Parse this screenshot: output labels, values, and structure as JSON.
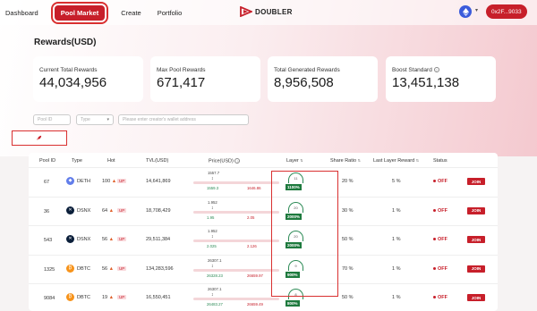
{
  "nav": {
    "links": [
      "Dashboard",
      "Pool Market",
      "Create",
      "Portfolio"
    ],
    "active": "Pool Market",
    "logo_text": "DOUBLER",
    "wallet": "0x2F...9033"
  },
  "page": {
    "title": "Rewards(USD)"
  },
  "stats": [
    {
      "label": "Current Total Rewards",
      "value": "44,034,956"
    },
    {
      "label": "Max Pool Rewards",
      "value": "671,417"
    },
    {
      "label": "Total Generated Rewards",
      "value": "8,956,508"
    },
    {
      "label": "Boost Standard",
      "value": "13,451,138"
    }
  ],
  "filters": {
    "pool_id_placeholder": "Pool ID",
    "type_placeholder": "Type",
    "creator_placeholder": "Please enter creator's wallet address"
  },
  "table": {
    "headers": [
      "Pool ID",
      "Type",
      "Hot",
      "TVL(USD)",
      "Price(USD)",
      "Layer",
      "Share Ratio",
      "Last Layer Reward",
      "Status"
    ],
    "rows": [
      {
        "pool_id": "67",
        "type": "DETH",
        "hot": "100",
        "tvl": "14,641,869",
        "price_top": "1557.7",
        "price_cur": "1559.3",
        "price_max": "1646.86",
        "layer": "11",
        "layer_pct": "1100%",
        "share": "20 %",
        "last_reward": "5 %",
        "status": "OFF",
        "join": "JOIN"
      },
      {
        "pool_id": "36",
        "type": "DSNX",
        "hot": "64",
        "tvl": "18,708,429",
        "price_top": "1.952",
        "price_cur": "1.95",
        "price_max": "2.05",
        "layer": "20",
        "layer_pct": "2000%",
        "share": "30 %",
        "last_reward": "1 %",
        "status": "OFF",
        "join": "JOIN"
      },
      {
        "pool_id": "543",
        "type": "DSNX",
        "hot": "56",
        "tvl": "29,511,384",
        "price_top": "1.952",
        "price_cur": "2.025",
        "price_max": "2.126",
        "layer": "20",
        "layer_pct": "2000%",
        "share": "50 %",
        "last_reward": "1 %",
        "status": "OFF",
        "join": "JOIN"
      },
      {
        "pool_id": "1325",
        "type": "DBTC",
        "hot": "56",
        "tvl": "134,283,596",
        "price_top": "26307.1",
        "price_cur": "26328.23",
        "price_max": "26659.97",
        "layer": "9",
        "layer_pct": "900%",
        "share": "70 %",
        "last_reward": "1 %",
        "status": "OFF",
        "join": "JOIN"
      },
      {
        "pool_id": "9084",
        "type": "DBTC",
        "hot": "19",
        "tvl": "16,550,451",
        "price_top": "26307.1",
        "price_cur": "26483.27",
        "price_max": "26659.49",
        "layer": "8",
        "layer_pct": "800%",
        "share": "50 %",
        "last_reward": "1 %",
        "status": "OFF",
        "join": "JOIN"
      }
    ],
    "up_label": "UP"
  },
  "colors": {
    "accent": "#c71f2a",
    "layer_green": "#1e7a3e"
  }
}
